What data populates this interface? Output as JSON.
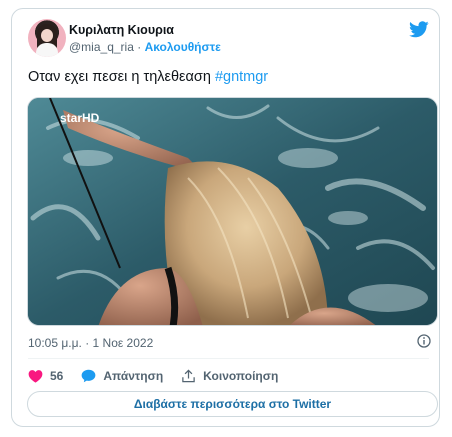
{
  "author": {
    "name": "Κυριλατη Κιουρια",
    "handle": "@mia_q_ria",
    "separator": "·",
    "follow_label": "Ακολουθήστε"
  },
  "tweet": {
    "text": "Οταν εχει πεσει η τηλεθεαση ",
    "hashtag": "#gntmgr",
    "media_watermark": "starHD"
  },
  "meta": {
    "timestamp": "10:05 μ.μ. · 1 Νοε 2022"
  },
  "actions": {
    "like_count": "56",
    "reply_label": "Απάντηση",
    "share_label": "Κοινοποίηση"
  },
  "read_more_label": "Διαβάστε περισσότερα στο Twitter",
  "colors": {
    "accent": "#1d9bf0",
    "like": "#f91880",
    "text": "#0f1419",
    "muted": "#536471",
    "border": "#cfd9de"
  },
  "icons": [
    "twitter-bird-icon",
    "info-icon",
    "heart-icon",
    "reply-bubble-icon",
    "share-icon"
  ]
}
